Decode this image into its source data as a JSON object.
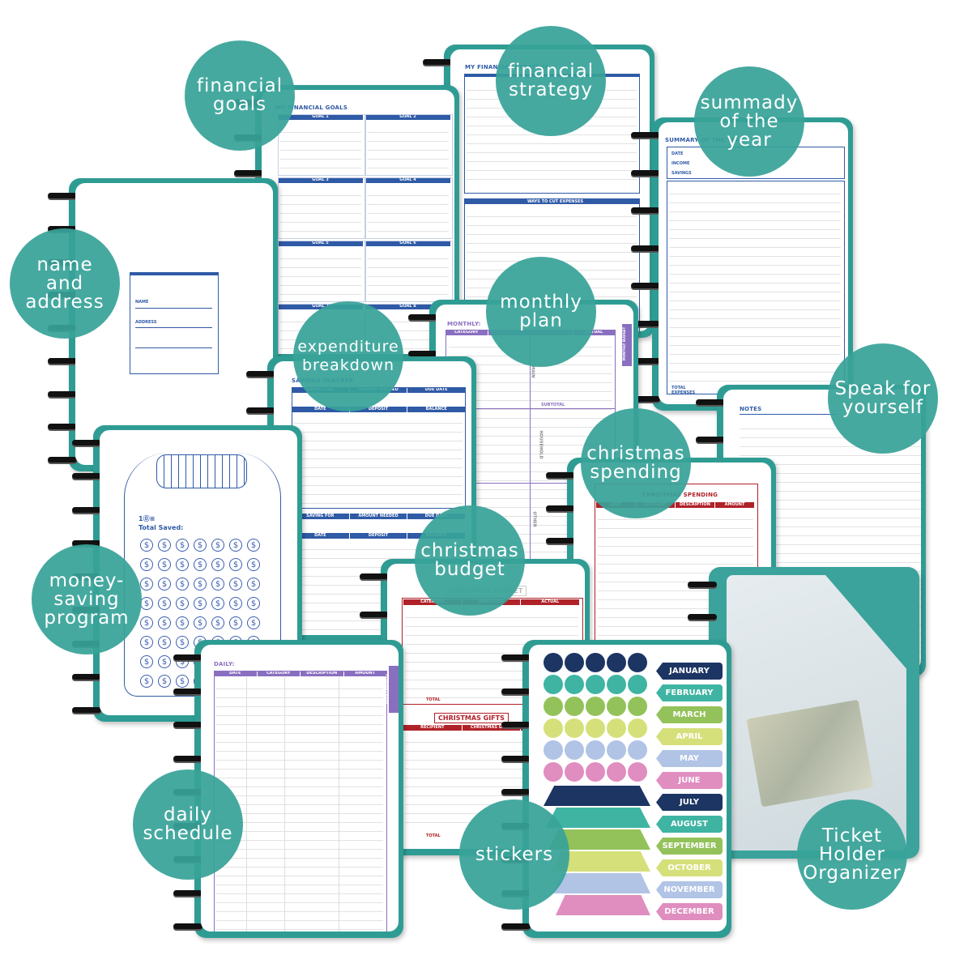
{
  "bubbles": [
    {
      "id": "financial-goals",
      "text": "financial\ngoals"
    },
    {
      "id": "financial-strategy",
      "text": "financial\nstrategy"
    },
    {
      "id": "summary-of-the-year",
      "text": "summady\nof the\nyear"
    },
    {
      "id": "name-and-address",
      "text": "name\nand\naddress"
    },
    {
      "id": "monthly-plan",
      "text": "monthly\nplan"
    },
    {
      "id": "expenditure-breakdown",
      "text": "expenditure\nbreakdown"
    },
    {
      "id": "speak-for-yourself",
      "text": "Speak for\nyourself"
    },
    {
      "id": "christmas-spending",
      "text": "christmas\nspending"
    },
    {
      "id": "christmas-budget",
      "text": "christmas\nbudget"
    },
    {
      "id": "money-saving-program",
      "text": "money-\nsaving\nprogram"
    },
    {
      "id": "daily-schedule",
      "text": "daily\nschedule"
    },
    {
      "id": "stickers",
      "text": "stickers"
    },
    {
      "id": "ticket-holder-organizer",
      "text": "Ticket\nHolder\nOrganizer"
    }
  ],
  "pages": {
    "strategy": {
      "title": "MY FINANCIAL STRATEGY",
      "section": "WAYS TO CUT EXPENSES"
    },
    "goals": {
      "title": "MY FINANCIAL GOALS",
      "goals": [
        "GOAL 1",
        "GOAL 2",
        "GOAL 3",
        "GOAL 4",
        "GOAL 5",
        "GOAL 6",
        "GOAL 7",
        "GOAL 8"
      ]
    },
    "summary": {
      "title": "SUMMARY OF THE YEAR",
      "rows": [
        "DATE",
        "INCOME",
        "SAVINGS"
      ],
      "footer": "TOTAL EXPENSES"
    },
    "name": {
      "fields": [
        "NAME",
        "ADDRESS"
      ]
    },
    "monthly": {
      "title": "MONTHLY:",
      "headers": [
        "CATEGORY",
        "",
        "",
        "ACTUAL"
      ],
      "tab": "MONTHLY BUDGET",
      "sections": [
        "MAIN",
        "HOUSEHOLD",
        "OTHER"
      ],
      "subtotal": "SUBTOTAL"
    },
    "savings": {
      "title": "SAVINGS TRACKER",
      "headers1": [
        "SAVING FOR",
        "AMOUNT NEEDED",
        "DUE DATE"
      ],
      "headers2": [
        "DATE",
        "DEPOSIT",
        "BALANCE"
      ]
    },
    "notes": {
      "title": "NOTES"
    },
    "xmas_spending": {
      "title": "CHRISTMAS SPENDING",
      "headers": [
        "DATE",
        "CATEGORY",
        "DESCRIPTION",
        "AMOUNT"
      ]
    },
    "xmas_budget": {
      "title": "CHRISTMAS BUDGET",
      "headers": [
        "CATEGORY",
        "BUDGETED",
        "ACTUAL"
      ],
      "total": "TOTAL",
      "gifts_title": "CHRISTMAS GIFTS",
      "gifts_headers": [
        "RECIPIENT",
        "CHRISTMAS GIFTS",
        "BUDGET"
      ]
    },
    "jar": {
      "goal": "1⓪≡",
      "label": "Total Saved:",
      "coin": "$"
    },
    "daily": {
      "title": "DAILY:",
      "headers": [
        "DATE",
        "CATEGORY",
        "DESCRIPTION",
        "AMOUNT"
      ],
      "tab": "DAILY EXPENSES"
    },
    "stickers": {
      "months": [
        "JANUARY",
        "FEBRUARY",
        "MARCH",
        "APRIL",
        "MAY",
        "JUNE",
        "JULY",
        "AUGUST",
        "SEPTEMBER",
        "OCTOBER",
        "NOVEMBER",
        "DECEMBER"
      ]
    }
  },
  "colors": {
    "teal": "#2f9c94",
    "bubble": "#38a399",
    "blue": "#2f5aa6",
    "purple": "#8a6fc0",
    "red": "#b02229",
    "stickers": [
      "#1c3563",
      "#3fb4a3",
      "#93c25a",
      "#d6e07a",
      "#b1c4e6",
      "#e08dc0",
      "#1c3563",
      "#3fb4a3",
      "#93c25a",
      "#d6e07a",
      "#b1c4e6",
      "#e08dc0"
    ]
  }
}
